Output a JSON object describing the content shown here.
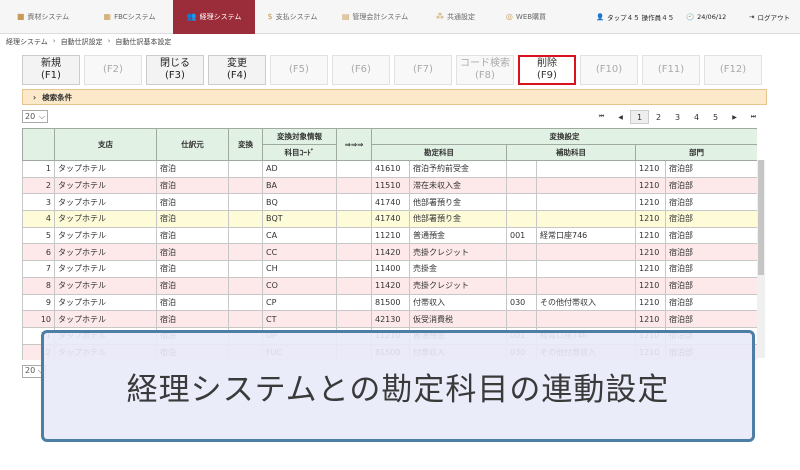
{
  "nav": {
    "tabs": [
      {
        "label": "資材システム",
        "icon": "box-icon",
        "glyph": "■"
      },
      {
        "label": "FBCシステム",
        "icon": "grid-icon",
        "glyph": "▦"
      },
      {
        "label": "経理システム",
        "icon": "users-icon",
        "glyph": "👥",
        "active": true
      },
      {
        "label": "支払システム",
        "icon": "dollar-icon",
        "glyph": "$"
      },
      {
        "label": "管理会計システム",
        "icon": "chart-icon",
        "glyph": "▤"
      },
      {
        "label": "共通設定",
        "icon": "sitemap-icon",
        "glyph": "⁂"
      },
      {
        "label": "WEB購買",
        "icon": "globe-icon",
        "glyph": "◎"
      }
    ],
    "user": "タップ４５ 操作員４５",
    "date": "24/06/12",
    "logout": "ログアウト",
    "active_color": "#9b2c3a"
  },
  "breadcrumb": [
    "経理システム",
    "自動仕訳設定",
    "自動仕訳基本設定"
  ],
  "fkeys": [
    {
      "label": "新規",
      "key": "(F1)",
      "enabled": true
    },
    {
      "label": "",
      "key": "(F2)",
      "enabled": false
    },
    {
      "label": "閉じる",
      "key": "(F3)",
      "enabled": true
    },
    {
      "label": "変更",
      "key": "(F4)",
      "enabled": true
    },
    {
      "label": "",
      "key": "(F5)",
      "enabled": false
    },
    {
      "label": "",
      "key": "(F6)",
      "enabled": false
    },
    {
      "label": "",
      "key": "(F7)",
      "enabled": false
    },
    {
      "label": "コード検索",
      "key": "(F8)",
      "enabled": false
    },
    {
      "label": "削除",
      "key": "(F9)",
      "enabled": true,
      "highlight": true
    },
    {
      "label": "",
      "key": "(F10)",
      "enabled": false
    },
    {
      "label": "",
      "key": "(F11)",
      "enabled": false
    },
    {
      "label": "",
      "key": "(F12)",
      "enabled": false
    }
  ],
  "search_label": "検索条件",
  "page_size": "20",
  "pager": {
    "pages": [
      "1",
      "2",
      "3",
      "4",
      "5"
    ],
    "current": "1"
  },
  "table": {
    "headers": {
      "shiten": "支店",
      "shiwakemoto": "仕訳元",
      "henkan": "変換",
      "taisho": "変換対象情報",
      "arrow": "⇒⇒⇒",
      "settei": "変換設定",
      "kamoku_code": "科目ｺｰﾄﾞ",
      "kanjo": "勘定科目",
      "hojo": "補助科目",
      "bumon": "部門"
    },
    "rows": [
      {
        "no": "1",
        "shiten": "タップホテル",
        "moto": "宿泊",
        "code": "AD",
        "kcode": "41610",
        "kname": "宿泊予約前受金",
        "hcode": "",
        "hname": "",
        "bcode": "1210",
        "bname": "宿泊部"
      },
      {
        "no": "2",
        "shiten": "タップホテル",
        "moto": "宿泊",
        "code": "BA",
        "kcode": "11510",
        "kname": "滞在未収入金",
        "hcode": "",
        "hname": "",
        "bcode": "1210",
        "bname": "宿泊部"
      },
      {
        "no": "3",
        "shiten": "タップホテル",
        "moto": "宿泊",
        "code": "BQ",
        "kcode": "41740",
        "kname": "他部署預り金",
        "hcode": "",
        "hname": "",
        "bcode": "1210",
        "bname": "宿泊部"
      },
      {
        "no": "4",
        "shiten": "タップホテル",
        "moto": "宿泊",
        "code": "BQT",
        "kcode": "41740",
        "kname": "他部署預り金",
        "hcode": "",
        "hname": "",
        "bcode": "1210",
        "bname": "宿泊部"
      },
      {
        "no": "5",
        "shiten": "タップホテル",
        "moto": "宿泊",
        "code": "CA",
        "kcode": "11210",
        "kname": "普通預金",
        "hcode": "001",
        "hname": "経常口座746",
        "bcode": "1210",
        "bname": "宿泊部"
      },
      {
        "no": "6",
        "shiten": "タップホテル",
        "moto": "宿泊",
        "code": "CC",
        "kcode": "11420",
        "kname": "売掛クレジット",
        "hcode": "",
        "hname": "",
        "bcode": "1210",
        "bname": "宿泊部"
      },
      {
        "no": "7",
        "shiten": "タップホテル",
        "moto": "宿泊",
        "code": "CH",
        "kcode": "11400",
        "kname": "売掛金",
        "hcode": "",
        "hname": "",
        "bcode": "1210",
        "bname": "宿泊部"
      },
      {
        "no": "8",
        "shiten": "タップホテル",
        "moto": "宿泊",
        "code": "CO",
        "kcode": "11420",
        "kname": "売掛クレジット",
        "hcode": "",
        "hname": "",
        "bcode": "1210",
        "bname": "宿泊部"
      },
      {
        "no": "9",
        "shiten": "タップホテル",
        "moto": "宿泊",
        "code": "CP",
        "kcode": "81500",
        "kname": "付帯収入",
        "hcode": "030",
        "hname": "その他付帯収入",
        "bcode": "1210",
        "bname": "宿泊部"
      },
      {
        "no": "10",
        "shiten": "タップホテル",
        "moto": "宿泊",
        "code": "CT",
        "kcode": "42130",
        "kname": "仮受消費税",
        "hcode": "",
        "hname": "",
        "bcode": "1210",
        "bname": "宿泊部"
      },
      {
        "no": "11",
        "shiten": "タップホテル",
        "moto": "宿泊",
        "code": "DP",
        "kcode": "11210",
        "kname": "普通預金",
        "hcode": "001",
        "hname": "経常口座746",
        "bcode": "1210",
        "bname": "宿泊部"
      },
      {
        "no": "12",
        "shiten": "タップホテル",
        "moto": "宿泊",
        "code": "FUC",
        "kcode": "81500",
        "kname": "付帯収入",
        "hcode": "030",
        "hname": "その他付帯収入",
        "bcode": "1210",
        "bname": "宿泊部"
      }
    ]
  },
  "overlay_caption": "経理システムとの勘定科目の連動設定"
}
